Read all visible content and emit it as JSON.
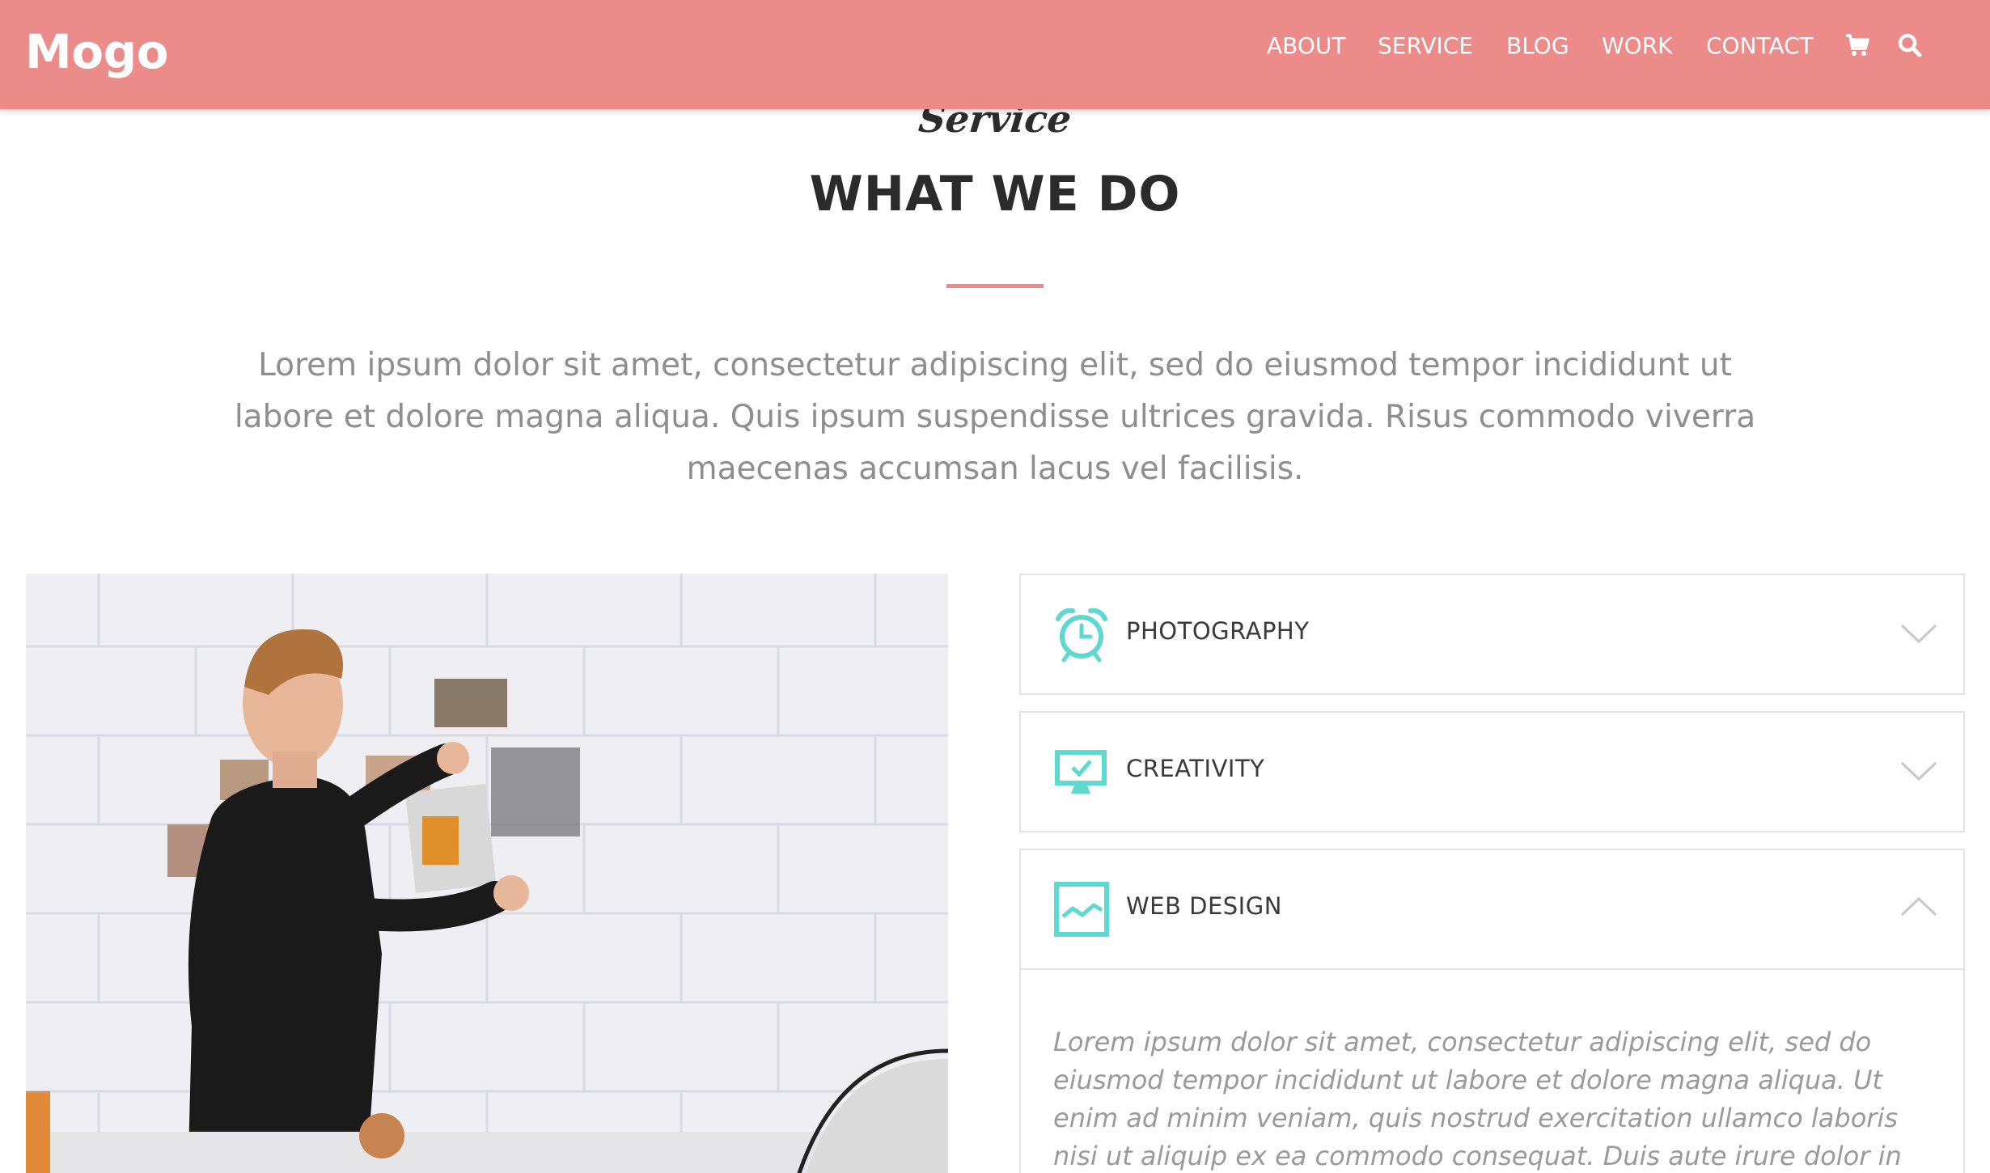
{
  "header": {
    "logo": "Mogo",
    "nav": [
      "ABOUT",
      "SERVICE",
      "BLOG",
      "WORK",
      "CONTACT"
    ],
    "icons": [
      "cart-icon",
      "search-icon"
    ],
    "color": "#ec8c8a"
  },
  "section": {
    "script_title": "Service",
    "title": "WHAT WE DO",
    "intro": "Lorem ipsum dolor sit amet, consectetur adipiscing elit, sed do eiusmod tempor incididunt ut labore et dolore magna aliqua. Quis ipsum suspendisse ultrices gravida. Risus commodo viverra maecenas accumsan lacus vel facilisis."
  },
  "accordion": {
    "accent": "#5fd8d0",
    "items": [
      {
        "label": "PHOTOGRAPHY",
        "icon": "alarm-clock-icon",
        "expanded": false
      },
      {
        "label": "CREATIVITY",
        "icon": "monitor-check-icon",
        "expanded": false
      },
      {
        "label": "WEB DESIGN",
        "icon": "line-chart-icon",
        "expanded": true,
        "body": "Lorem ipsum dolor sit amet, consectetur adipiscing elit, sed do eiusmod tempor incididunt ut labore et dolore magna aliqua. Ut enim ad minim veniam, quis nostrud exercitation ullamco laboris nisi ut aliquip ex ea commodo consequat. Duis aute irure dolor in reprehenderit in voluptate"
      }
    ]
  }
}
